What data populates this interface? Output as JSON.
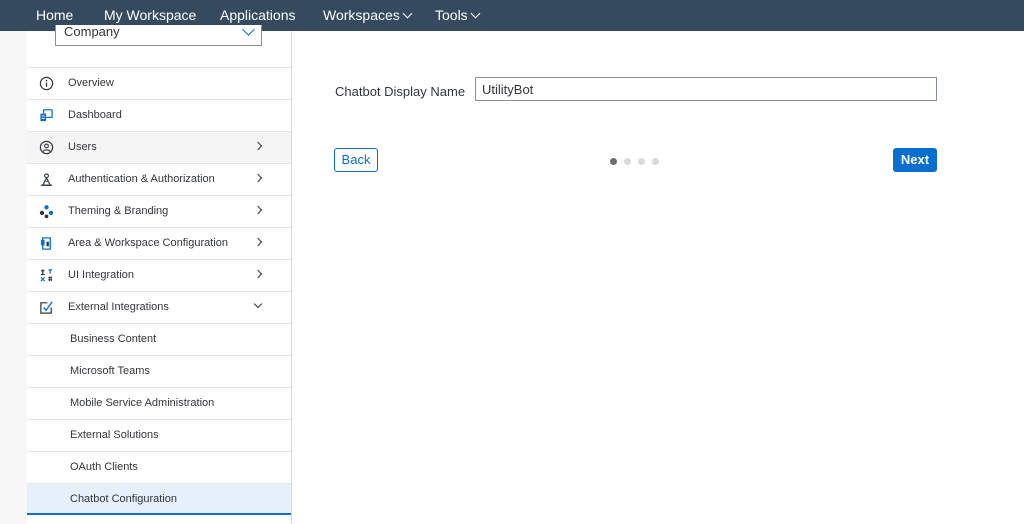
{
  "topnav": {
    "items": [
      {
        "label": "Home",
        "dropdown": false
      },
      {
        "label": "My Workspace",
        "dropdown": false
      },
      {
        "label": "Applications",
        "dropdown": false
      },
      {
        "label": "Workspaces",
        "dropdown": true
      },
      {
        "label": "Tools",
        "dropdown": true
      }
    ]
  },
  "sidebar": {
    "selector_value": "Company",
    "items": [
      {
        "label": "Overview",
        "icon": "info-icon",
        "expander": "none"
      },
      {
        "label": "Dashboard",
        "icon": "dashboard-icon",
        "expander": "none"
      },
      {
        "label": "Users",
        "icon": "user-icon",
        "expander": "right"
      },
      {
        "label": "Authentication & Authorization",
        "icon": "authentication-icon",
        "expander": "right"
      },
      {
        "label": "Theming & Branding",
        "icon": "theming-icon",
        "expander": "right"
      },
      {
        "label": "Area & Workspace Configuration",
        "icon": "workspace-config-icon",
        "expander": "right"
      },
      {
        "label": "UI Integration",
        "icon": "ui-integration-icon",
        "expander": "right"
      },
      {
        "label": "External Integrations",
        "icon": "external-integrations-icon",
        "expander": "down"
      }
    ],
    "subitems": [
      {
        "label": "Business Content"
      },
      {
        "label": "Microsoft Teams"
      },
      {
        "label": "Mobile Service Administration"
      },
      {
        "label": "External Solutions"
      },
      {
        "label": "OAuth Clients"
      },
      {
        "label": "Chatbot Configuration"
      }
    ]
  },
  "main": {
    "display_name_label": "Chatbot Display Name",
    "display_name_value": "UtilityBot",
    "back_label": "Back",
    "next_label": "Next",
    "step_current": 1,
    "step_total": 4
  },
  "colors": {
    "header_bg": "#354a5f",
    "accent": "#0a6ed1",
    "selected_bg": "#e5f0fa"
  }
}
